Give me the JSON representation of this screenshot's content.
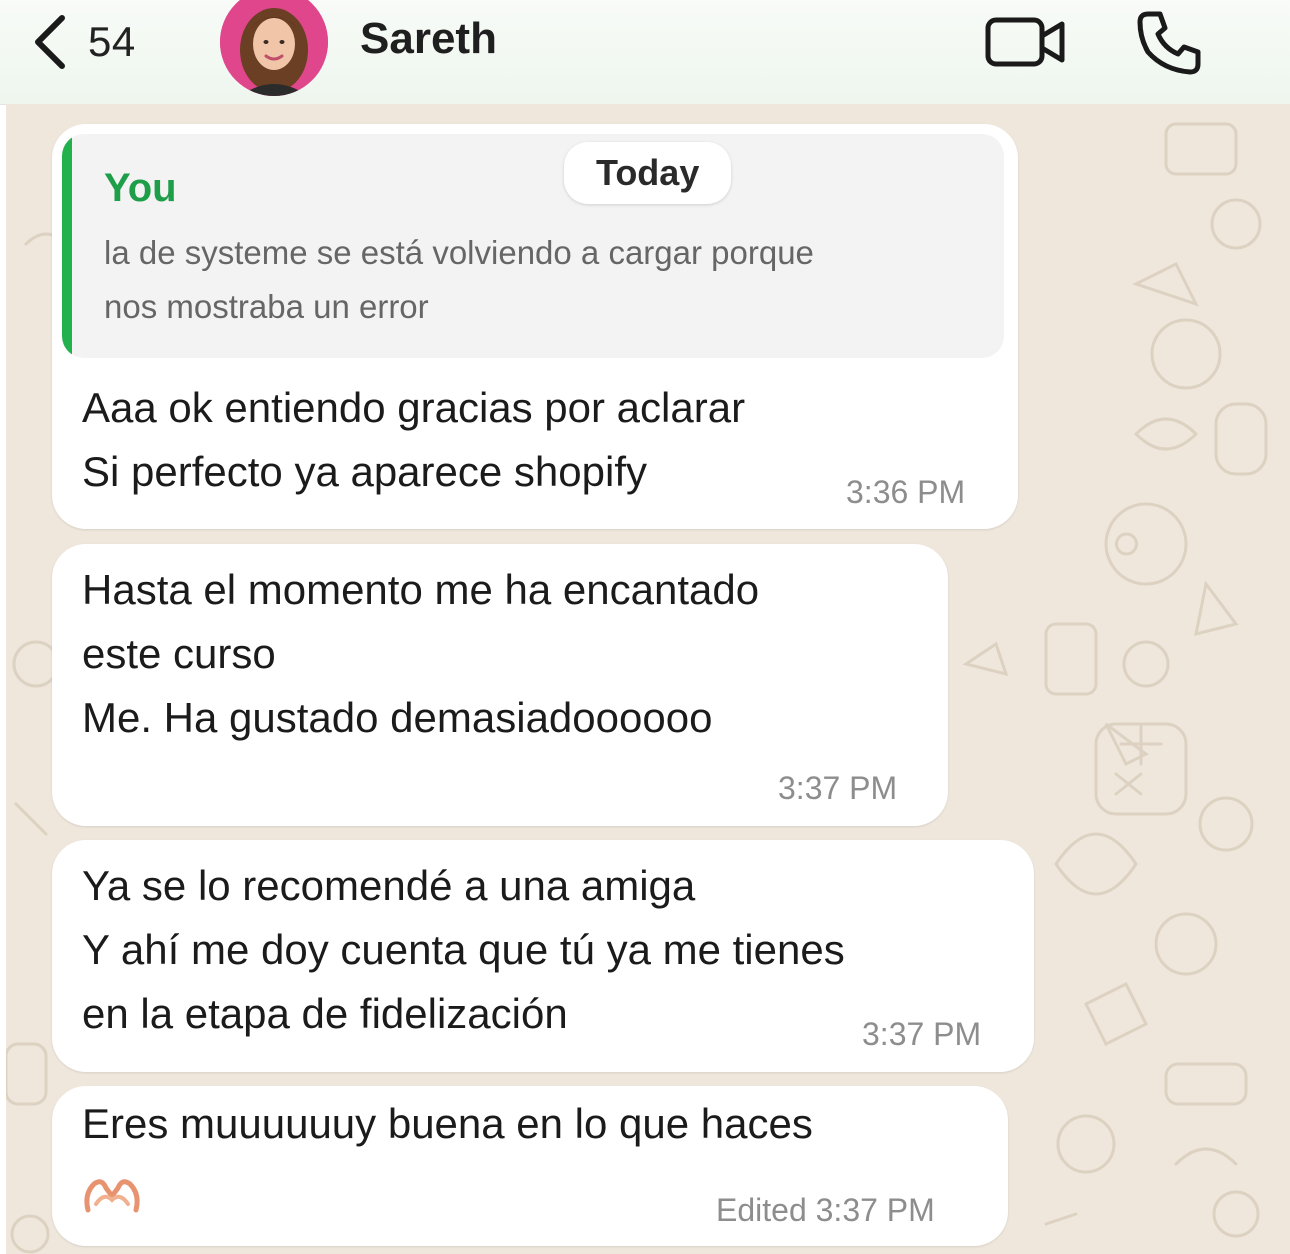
{
  "header": {
    "back_count": "54",
    "contact_name": "Sareth",
    "icons": {
      "back": "chevron-left-icon",
      "video": "video-camera-icon",
      "call": "phone-icon"
    }
  },
  "date_divider": "Today",
  "messages": [
    {
      "quote": {
        "author": "You",
        "text": "la de systeme se está volviendo a cargar porque\nnos mostraba un error"
      },
      "text": "Aaa ok entiendo gracias por aclarar\nSi perfecto ya aparece shopify",
      "time": "3:36 PM"
    },
    {
      "text": "Hasta el momento me ha encantado\neste curso\nMe. Ha gustado demasiadoooooo",
      "time": "3:37 PM"
    },
    {
      "text": "Ya se lo recomendé a una amiga\nY ahí me doy cuenta que tú ya me tienes\nen la etapa de fidelización",
      "time": "3:37 PM"
    },
    {
      "text": "Eres muuuuuuy buena en lo que haces",
      "emoji": "heart-hands-icon",
      "time": "Edited 3:37 PM"
    }
  ],
  "colors": {
    "quote_accent": "#22b14c",
    "quote_author": "#1f9e4a",
    "wallpaper": "#efe7dc",
    "bubble": "#ffffff"
  }
}
